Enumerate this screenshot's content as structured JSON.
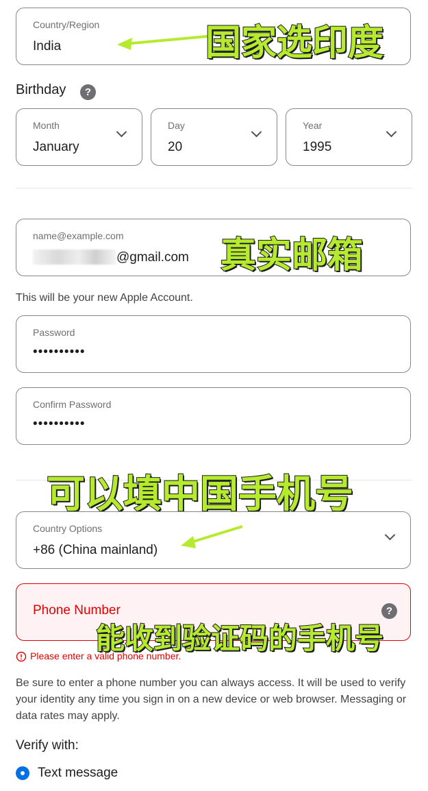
{
  "country_region": {
    "label": "Country/Region",
    "value": "India"
  },
  "birthday": {
    "heading": "Birthday",
    "help_icon": "question-icon",
    "month": {
      "label": "Month",
      "value": "January"
    },
    "day": {
      "label": "Day",
      "value": "20"
    },
    "year": {
      "label": "Year",
      "value": "1995"
    }
  },
  "email": {
    "placeholder_label": "name@example.com",
    "value_suffix": "@gmail.com",
    "note": "This will be your new Apple Account."
  },
  "password": {
    "label": "Password",
    "value": "••••••••••"
  },
  "confirm_password": {
    "label": "Confirm Password",
    "value": "••••••••••"
  },
  "country_options": {
    "label": "Country Options",
    "value": "+86 (China mainland)"
  },
  "phone": {
    "label": "Phone Number",
    "error": "Please enter a valid phone number.",
    "help_icon": "question-icon"
  },
  "info_text": "Be sure to enter a phone number you can always access. It will be used to verify your identity any time you sign in on a new device or web browser. Messaging or data rates may apply.",
  "verify": {
    "heading": "Verify with:",
    "option": "Text message"
  },
  "annotations": {
    "country": "国家选印度",
    "email": "真实邮箱",
    "china_phone": "可以填中国手机号",
    "phone_code": "能收到验证码的手机号"
  },
  "colors": {
    "accent": "#0071e3",
    "error": "#e30000",
    "annotation": "#b6ea2e"
  }
}
